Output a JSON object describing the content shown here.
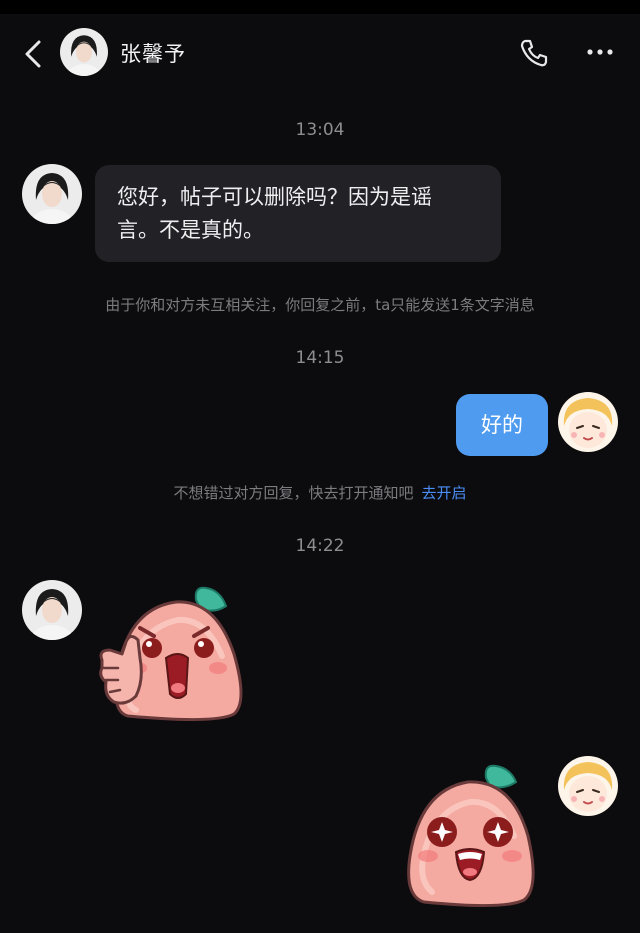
{
  "header": {
    "back_icon": "chevron-left-icon",
    "contact_name": "张馨予",
    "phone_icon": "phone-icon",
    "more_icon": "more-horizontal-icon"
  },
  "messages": {
    "time_1": "13:04",
    "incoming_text_line1": "您好，帖子可以删除吗？因为是谣",
    "incoming_text_line2": "言。不是真的。",
    "system_notice_1": "由于你和对方未互相关注，你回复之前，ta只能发送1条文字消息",
    "time_2": "14:15",
    "outgoing_text": "好的",
    "system_notice_2": "不想错过对方回复，快去打开通知吧",
    "system_notice_2_link": "去开启",
    "time_3": "14:22",
    "incoming_sticker": "thumbs-up-peach-sticker",
    "outgoing_sticker": "starry-eyes-peach-sticker"
  },
  "colors": {
    "background": "#0c0c0e",
    "incoming_bubble": "#222226",
    "outgoing_bubble": "#4f9bf0",
    "link": "#4a8df5"
  }
}
